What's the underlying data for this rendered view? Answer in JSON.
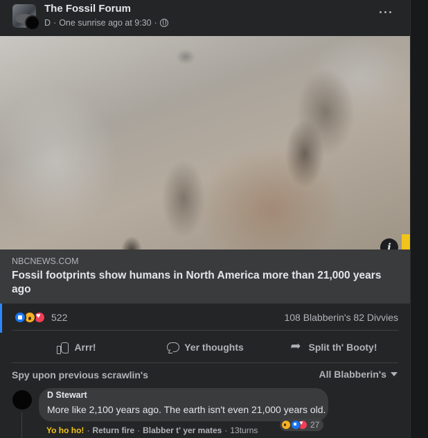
{
  "post": {
    "group_name": "The Fossil Forum",
    "author": "D",
    "timestamp": "One sunrise ago at 9:30",
    "privacy_icon": "globe-icon",
    "more_icon": "ellipsis-icon"
  },
  "link": {
    "domain": "NBCNEWS.COM",
    "title": "Fossil footprints show humans in North America more than 21,000 years ago"
  },
  "reactions": {
    "count": "522",
    "stats": "108 Blabberin's  82 Divvies"
  },
  "actions": {
    "like": "Arrr!",
    "comment": "Yer thoughts",
    "share": "Split th' Booty!"
  },
  "comments": {
    "previous": "Spy upon previous scrawlin's",
    "filter": "All Blabberin's",
    "items": [
      {
        "author": "D Stewart",
        "text": "More like 2,100 years ago. The earth isn't even 21,000 years old.",
        "reaction_count": "27",
        "like_label": "Yo ho ho!",
        "reply_label": "Return fire",
        "translate_label": "Blabber t' yer mates",
        "age": "13turns"
      }
    ]
  },
  "colors": {
    "background": "#242526",
    "link_box": "#3a3b3c",
    "accent": "#2d88ff",
    "like_highlight": "#f0c419",
    "text_secondary": "#b0b3b8"
  }
}
